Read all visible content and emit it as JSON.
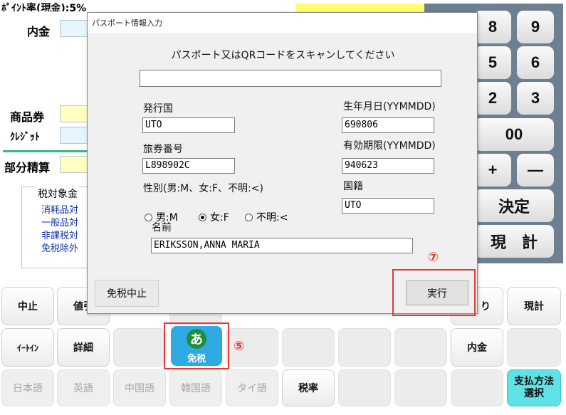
{
  "background": {
    "point_rate_label": "ﾎﾟｲﾝﾄ率(現金):5%",
    "deposit_label": "内金",
    "gift_label": "商品券",
    "credit_label": "ｸﾚｼﾞｯﾄ",
    "partial_label": "部分精算",
    "tax_section_title": "税対象金",
    "tax_items": [
      "消耗品対",
      "一般品対",
      "非課税対",
      "免税除外"
    ]
  },
  "keypad": {
    "keys": [
      "8",
      "9",
      "5",
      "6",
      "2",
      "3",
      "00",
      "+",
      "—",
      "決定",
      "現　計"
    ]
  },
  "bottom_buttons": {
    "row1": [
      "中止",
      "値引",
      "",
      "",
      "",
      "",
      "",
      "",
      "り",
      "現計"
    ],
    "row2": [
      "ｲｰﾄｲﾝ",
      "詳細",
      "",
      "",
      "",
      "",
      "",
      "",
      "内金",
      ""
    ],
    "row3": [
      "日本語",
      "英語",
      "中国語",
      "韓国語",
      "タイ語",
      "税率",
      "",
      "",
      "",
      "支払方法選択"
    ],
    "row3_last_line1": "支払方法",
    "row3_last_line2": "選択",
    "tax_free_icon": "あ",
    "tax_free_label": "免税",
    "marker_5": "⑤"
  },
  "dialog": {
    "title": "パスポート情報入力",
    "instruction": "パスポート又はQRコードをスキャンしてください",
    "scan_value": "",
    "issuing_country_label": "発行国",
    "issuing_country_value": "UTO",
    "passport_number_label": "旅券番号",
    "passport_number_value": "L898902C",
    "gender_label": "性別(男:M、女:F、不明:<)",
    "gender_options": [
      "男:M",
      "女:F",
      "不明:<"
    ],
    "gender_selected": "女:F",
    "birth_date_label": "生年月日(YYMMDD)",
    "birth_date_value": "690806",
    "expiry_label": "有効期限(YYMMDD)",
    "expiry_value": "940623",
    "nationality_label": "国籍",
    "nationality_value": "UTO",
    "name_label": "名前",
    "name_value": "ERIKSSON,ANNA MARIA",
    "cancel_tax_free_label": "免税中止",
    "execute_label": "実行",
    "marker_7": "⑦"
  },
  "colors": {
    "highlight_red": "#e53935",
    "tax_free_blue": "#2ea9e1",
    "payment_cyan": "#5fe1e6",
    "keypad_panel": "#6f7f92"
  }
}
